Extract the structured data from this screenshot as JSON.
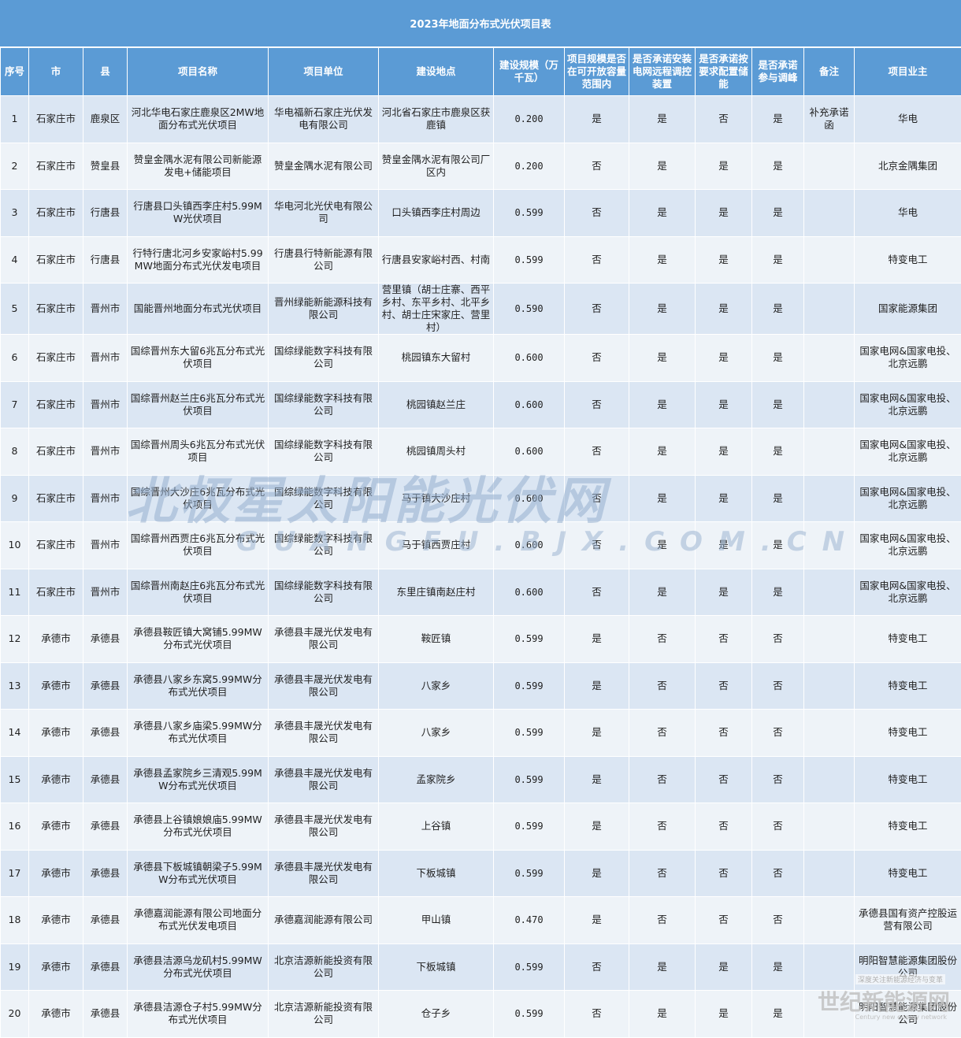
{
  "title": "2023年地面分布式光伏项目表",
  "headers": [
    "序号",
    "市",
    "县",
    "项目名称",
    "项目单位",
    "建设地点",
    "建设规模（万千瓦）",
    "项目规模是否在可开放容量范围内",
    "是否承诺安装电网远程调控装置",
    "是否承诺按要求配置储能",
    "是否承诺参与调峰",
    "备注",
    "项目业主"
  ],
  "rows": [
    [
      "1",
      "石家庄市",
      "鹿泉区",
      "河北华电石家庄鹿泉区2MW地面分布式光伏项目",
      "华电福新石家庄光伏发电有限公司",
      "河北省石家庄市鹿泉区获鹿镇",
      "0.200",
      "是",
      "是",
      "否",
      "是",
      "补充承诺函",
      "华电"
    ],
    [
      "2",
      "石家庄市",
      "赞皇县",
      "赞皇金隅水泥有限公司新能源发电+储能项目",
      "赞皇金隅水泥有限公司",
      "赞皇金隅水泥有限公司厂区内",
      "0.200",
      "否",
      "是",
      "是",
      "是",
      "",
      "北京金隅集团"
    ],
    [
      "3",
      "石家庄市",
      "行唐县",
      "行唐县口头镇西李庄村5.99MW光伏项目",
      "华电河北光伏电有限公司",
      "口头镇西李庄村周边",
      "0.599",
      "否",
      "是",
      "是",
      "是",
      "",
      "华电"
    ],
    [
      "4",
      "石家庄市",
      "行唐县",
      "行特行唐北河乡安家峪村5.99MW地面分布式光伏发电项目",
      "行唐县行特新能源有限公司",
      "行唐县安家峪村西、村南",
      "0.599",
      "否",
      "是",
      "是",
      "是",
      "",
      "特变电工"
    ],
    [
      "5",
      "石家庄市",
      "晋州市",
      "国能晋州地面分布式光伏项目",
      "晋州绿能新能源科技有限公司",
      "营里镇（胡士庄寨、西平乡村、东平乡村、北平乡村、胡士庄宋家庄、营里村）",
      "0.590",
      "否",
      "是",
      "是",
      "是",
      "",
      "国家能源集团"
    ],
    [
      "6",
      "石家庄市",
      "晋州市",
      "国综晋州东大留6兆瓦分布式光伏项目",
      "国综绿能数字科技有限公司",
      "桃园镇东大留村",
      "0.600",
      "否",
      "是",
      "是",
      "是",
      "",
      "国家电网&国家电投、北京远鹏"
    ],
    [
      "7",
      "石家庄市",
      "晋州市",
      "国综晋州赵兰庄6兆瓦分布式光伏项目",
      "国综绿能数字科技有限公司",
      "桃园镇赵兰庄",
      "0.600",
      "否",
      "是",
      "是",
      "是",
      "",
      "国家电网&国家电投、北京远鹏"
    ],
    [
      "8",
      "石家庄市",
      "晋州市",
      "国综晋州周头6兆瓦分布式光伏项目",
      "国综绿能数字科技有限公司",
      "桃园镇周头村",
      "0.600",
      "否",
      "是",
      "是",
      "是",
      "",
      "国家电网&国家电投、北京远鹏"
    ],
    [
      "9",
      "石家庄市",
      "晋州市",
      "国综晋州大沙庄6兆瓦分布式光伏项目",
      "国综绿能数字科技有限公司",
      "马于镇大沙庄村",
      "0.600",
      "否",
      "是",
      "是",
      "是",
      "",
      "国家电网&国家电投、北京远鹏"
    ],
    [
      "10",
      "石家庄市",
      "晋州市",
      "国综晋州西贾庄6兆瓦分布式光伏项目",
      "国综绿能数字科技有限公司",
      "马于镇西贾庄村",
      "0.600",
      "否",
      "是",
      "是",
      "是",
      "",
      "国家电网&国家电投、北京远鹏"
    ],
    [
      "11",
      "石家庄市",
      "晋州市",
      "国综晋州南赵庄6兆瓦分布式光伏项目",
      "国综绿能数字科技有限公司",
      "东里庄镇南赵庄村",
      "0.600",
      "否",
      "是",
      "是",
      "是",
      "",
      "国家电网&国家电投、北京远鹏"
    ],
    [
      "12",
      "承德市",
      "承德县",
      "承德县鞍匠镇大窝铺5.99MW分布式光伏项目",
      "承德县丰晟光伏发电有限公司",
      "鞍匠镇",
      "0.599",
      "是",
      "否",
      "否",
      "否",
      "",
      "特变电工"
    ],
    [
      "13",
      "承德市",
      "承德县",
      "承德县八家乡东窝5.99MW分布式光伏项目",
      "承德县丰晟光伏发电有限公司",
      "八家乡",
      "0.599",
      "是",
      "否",
      "否",
      "否",
      "",
      "特变电工"
    ],
    [
      "14",
      "承德市",
      "承德县",
      "承德县八家乡庙梁5.99MW分布式光伏项目",
      "承德县丰晟光伏发电有限公司",
      "八家乡",
      "0.599",
      "是",
      "否",
      "否",
      "否",
      "",
      "特变电工"
    ],
    [
      "15",
      "承德市",
      "承德县",
      "承德县孟家院乡三清观5.99MW分布式光伏项目",
      "承德县丰晟光伏发电有限公司",
      "孟家院乡",
      "0.599",
      "是",
      "否",
      "否",
      "否",
      "",
      "特变电工"
    ],
    [
      "16",
      "承德市",
      "承德县",
      "承德县上谷镇娘娘庙5.99MW分布式光伏项目",
      "承德县丰晟光伏发电有限公司",
      "上谷镇",
      "0.599",
      "是",
      "否",
      "否",
      "否",
      "",
      "特变电工"
    ],
    [
      "17",
      "承德市",
      "承德县",
      "承德县下板城镇朝梁子5.99MW分布式光伏项目",
      "承德县丰晟光伏发电有限公司",
      "下板城镇",
      "0.599",
      "是",
      "否",
      "否",
      "否",
      "",
      "特变电工"
    ],
    [
      "18",
      "承德市",
      "承德县",
      "承德嘉润能源有限公司地面分布式光伏发电项目",
      "承德嘉润能源有限公司",
      "甲山镇",
      "0.470",
      "是",
      "否",
      "否",
      "否",
      "",
      "承德县国有资产控股运营有限公司"
    ],
    [
      "19",
      "承德市",
      "承德县",
      "承德县洁源乌龙矶村5.99MW分布式光伏项目",
      "北京洁源新能投资有限公司",
      "下板城镇",
      "0.599",
      "否",
      "是",
      "是",
      "是",
      "",
      "明阳智慧能源集团股份公司"
    ],
    [
      "20",
      "承德市",
      "承德县",
      "承德县洁源仓子村5.99MW分布式光伏项目",
      "北京洁源新能投资有限公司",
      "仓子乡",
      "0.599",
      "否",
      "是",
      "是",
      "是",
      "",
      "明阳智慧能源集团股份公司"
    ]
  ],
  "watermark": {
    "main": "北极星太阳能光伏网",
    "sub": "GUANGFU.BJX.COM.CN"
  },
  "corner_watermark": {
    "top": "深度关注新能源经济与变革",
    "main": "世纪新能源网",
    "sub": "Century new energy network"
  },
  "colors": {
    "header_bg": "#5b9bd5",
    "row_odd": "#dbe6f3",
    "row_even": "#eef3f8"
  }
}
